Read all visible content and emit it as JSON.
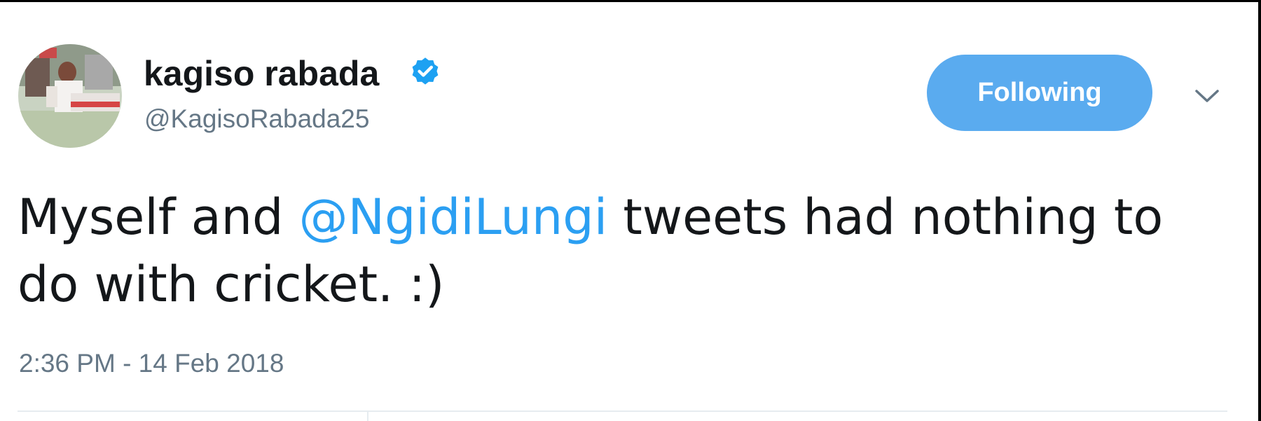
{
  "tweet": {
    "author": {
      "display_name": "kagiso rabada",
      "handle": "@KagisoRabada25",
      "verified": true,
      "avatar_icon": "avatar-photo"
    },
    "follow_button_label": "Following",
    "menu_icon": "chevron-down-icon",
    "text_parts": {
      "before": "Myself and ",
      "mention": "@NgidiLungi",
      "after": " tweets had nothing to do with cricket. :)"
    },
    "timestamp": "2:36 PM - 14 Feb 2018"
  },
  "colors": {
    "accent": "#5aabef",
    "mention": "#2b9ff2",
    "text": "#14171a",
    "secondary_text": "#657786",
    "verified_badge": "#1da1f2"
  }
}
